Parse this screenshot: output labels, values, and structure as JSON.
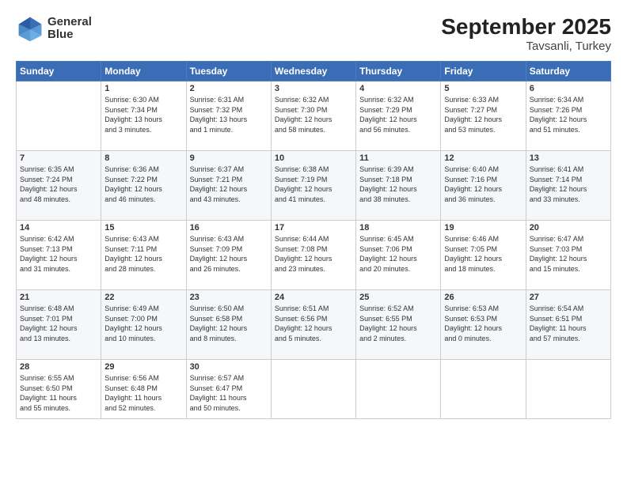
{
  "header": {
    "logo_line1": "General",
    "logo_line2": "Blue",
    "title": "September 2025",
    "subtitle": "Tavsanli, Turkey"
  },
  "weekdays": [
    "Sunday",
    "Monday",
    "Tuesday",
    "Wednesday",
    "Thursday",
    "Friday",
    "Saturday"
  ],
  "rows": [
    [
      {
        "day": "",
        "info": ""
      },
      {
        "day": "1",
        "info": "Sunrise: 6:30 AM\nSunset: 7:34 PM\nDaylight: 13 hours\nand 3 minutes."
      },
      {
        "day": "2",
        "info": "Sunrise: 6:31 AM\nSunset: 7:32 PM\nDaylight: 13 hours\nand 1 minute."
      },
      {
        "day": "3",
        "info": "Sunrise: 6:32 AM\nSunset: 7:30 PM\nDaylight: 12 hours\nand 58 minutes."
      },
      {
        "day": "4",
        "info": "Sunrise: 6:32 AM\nSunset: 7:29 PM\nDaylight: 12 hours\nand 56 minutes."
      },
      {
        "day": "5",
        "info": "Sunrise: 6:33 AM\nSunset: 7:27 PM\nDaylight: 12 hours\nand 53 minutes."
      },
      {
        "day": "6",
        "info": "Sunrise: 6:34 AM\nSunset: 7:26 PM\nDaylight: 12 hours\nand 51 minutes."
      }
    ],
    [
      {
        "day": "7",
        "info": "Sunrise: 6:35 AM\nSunset: 7:24 PM\nDaylight: 12 hours\nand 48 minutes."
      },
      {
        "day": "8",
        "info": "Sunrise: 6:36 AM\nSunset: 7:22 PM\nDaylight: 12 hours\nand 46 minutes."
      },
      {
        "day": "9",
        "info": "Sunrise: 6:37 AM\nSunset: 7:21 PM\nDaylight: 12 hours\nand 43 minutes."
      },
      {
        "day": "10",
        "info": "Sunrise: 6:38 AM\nSunset: 7:19 PM\nDaylight: 12 hours\nand 41 minutes."
      },
      {
        "day": "11",
        "info": "Sunrise: 6:39 AM\nSunset: 7:18 PM\nDaylight: 12 hours\nand 38 minutes."
      },
      {
        "day": "12",
        "info": "Sunrise: 6:40 AM\nSunset: 7:16 PM\nDaylight: 12 hours\nand 36 minutes."
      },
      {
        "day": "13",
        "info": "Sunrise: 6:41 AM\nSunset: 7:14 PM\nDaylight: 12 hours\nand 33 minutes."
      }
    ],
    [
      {
        "day": "14",
        "info": "Sunrise: 6:42 AM\nSunset: 7:13 PM\nDaylight: 12 hours\nand 31 minutes."
      },
      {
        "day": "15",
        "info": "Sunrise: 6:43 AM\nSunset: 7:11 PM\nDaylight: 12 hours\nand 28 minutes."
      },
      {
        "day": "16",
        "info": "Sunrise: 6:43 AM\nSunset: 7:09 PM\nDaylight: 12 hours\nand 26 minutes."
      },
      {
        "day": "17",
        "info": "Sunrise: 6:44 AM\nSunset: 7:08 PM\nDaylight: 12 hours\nand 23 minutes."
      },
      {
        "day": "18",
        "info": "Sunrise: 6:45 AM\nSunset: 7:06 PM\nDaylight: 12 hours\nand 20 minutes."
      },
      {
        "day": "19",
        "info": "Sunrise: 6:46 AM\nSunset: 7:05 PM\nDaylight: 12 hours\nand 18 minutes."
      },
      {
        "day": "20",
        "info": "Sunrise: 6:47 AM\nSunset: 7:03 PM\nDaylight: 12 hours\nand 15 minutes."
      }
    ],
    [
      {
        "day": "21",
        "info": "Sunrise: 6:48 AM\nSunset: 7:01 PM\nDaylight: 12 hours\nand 13 minutes."
      },
      {
        "day": "22",
        "info": "Sunrise: 6:49 AM\nSunset: 7:00 PM\nDaylight: 12 hours\nand 10 minutes."
      },
      {
        "day": "23",
        "info": "Sunrise: 6:50 AM\nSunset: 6:58 PM\nDaylight: 12 hours\nand 8 minutes."
      },
      {
        "day": "24",
        "info": "Sunrise: 6:51 AM\nSunset: 6:56 PM\nDaylight: 12 hours\nand 5 minutes."
      },
      {
        "day": "25",
        "info": "Sunrise: 6:52 AM\nSunset: 6:55 PM\nDaylight: 12 hours\nand 2 minutes."
      },
      {
        "day": "26",
        "info": "Sunrise: 6:53 AM\nSunset: 6:53 PM\nDaylight: 12 hours\nand 0 minutes."
      },
      {
        "day": "27",
        "info": "Sunrise: 6:54 AM\nSunset: 6:51 PM\nDaylight: 11 hours\nand 57 minutes."
      }
    ],
    [
      {
        "day": "28",
        "info": "Sunrise: 6:55 AM\nSunset: 6:50 PM\nDaylight: 11 hours\nand 55 minutes."
      },
      {
        "day": "29",
        "info": "Sunrise: 6:56 AM\nSunset: 6:48 PM\nDaylight: 11 hours\nand 52 minutes."
      },
      {
        "day": "30",
        "info": "Sunrise: 6:57 AM\nSunset: 6:47 PM\nDaylight: 11 hours\nand 50 minutes."
      },
      {
        "day": "",
        "info": ""
      },
      {
        "day": "",
        "info": ""
      },
      {
        "day": "",
        "info": ""
      },
      {
        "day": "",
        "info": ""
      }
    ]
  ]
}
